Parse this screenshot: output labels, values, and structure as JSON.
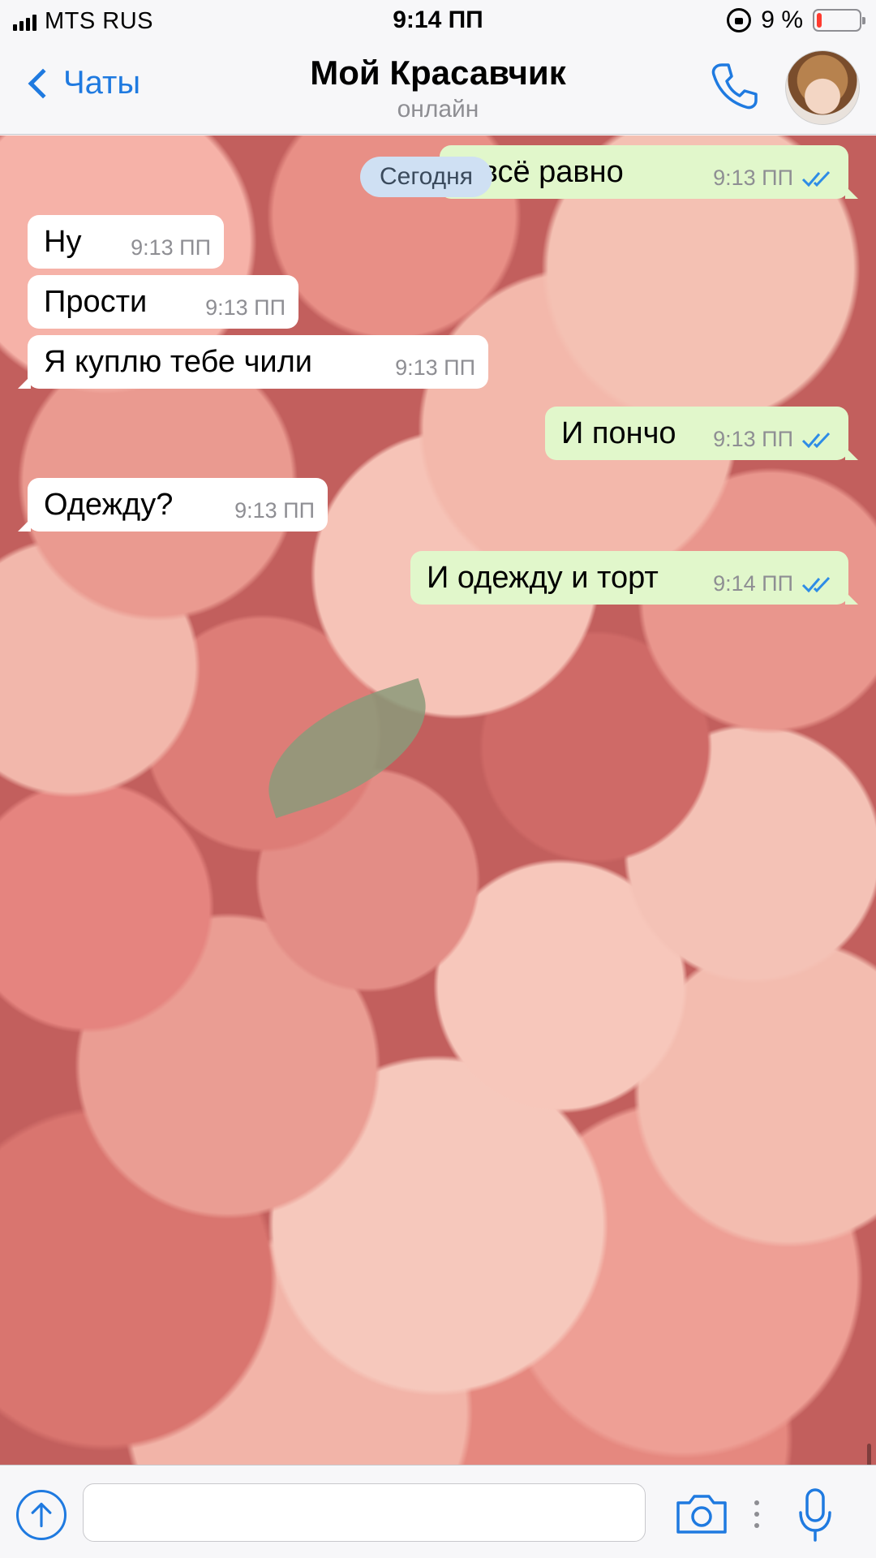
{
  "status_bar": {
    "carrier": "MTS RUS",
    "time": "9:14 ПП",
    "battery_percent": "9 %",
    "battery_level": 0.09,
    "battery_color": "#ff3b30",
    "signal_icon": "signal-bars-icon",
    "rotation_lock_icon": "rotation-lock-icon"
  },
  "nav": {
    "back_label": "Чаты",
    "title": "Мой Красавчик",
    "subtitle": "онлайн",
    "call_icon": "phone-icon",
    "accent_color": "#1f7ae0"
  },
  "chat": {
    "date_label": "Сегодня",
    "messages": [
      {
        "direction": "out",
        "text": "е всё равно",
        "time": "9:13 ПП",
        "read": true
      },
      {
        "direction": "in",
        "text": "Ну",
        "time": "9:13 ПП"
      },
      {
        "direction": "in",
        "text": "Прости",
        "time": "9:13 ПП"
      },
      {
        "direction": "in",
        "text": "Я куплю тебе чили",
        "time": "9:13 ПП"
      },
      {
        "direction": "out",
        "text": "И пончо",
        "time": "9:13 ПП",
        "read": true
      },
      {
        "direction": "in",
        "text": "Одежду?",
        "time": "9:13 ПП"
      },
      {
        "direction": "out",
        "text": "И одежду и торт",
        "time": "9:14 ПП",
        "read": true
      }
    ],
    "incoming_bubble_color": "#ffffff",
    "outgoing_bubble_color": "#e1f7cb"
  },
  "input_bar": {
    "placeholder": "",
    "value": "",
    "attach_icon": "upload-arrow-icon",
    "camera_icon": "camera-icon",
    "more_icon": "more-dots-icon",
    "mic_icon": "microphone-icon"
  }
}
